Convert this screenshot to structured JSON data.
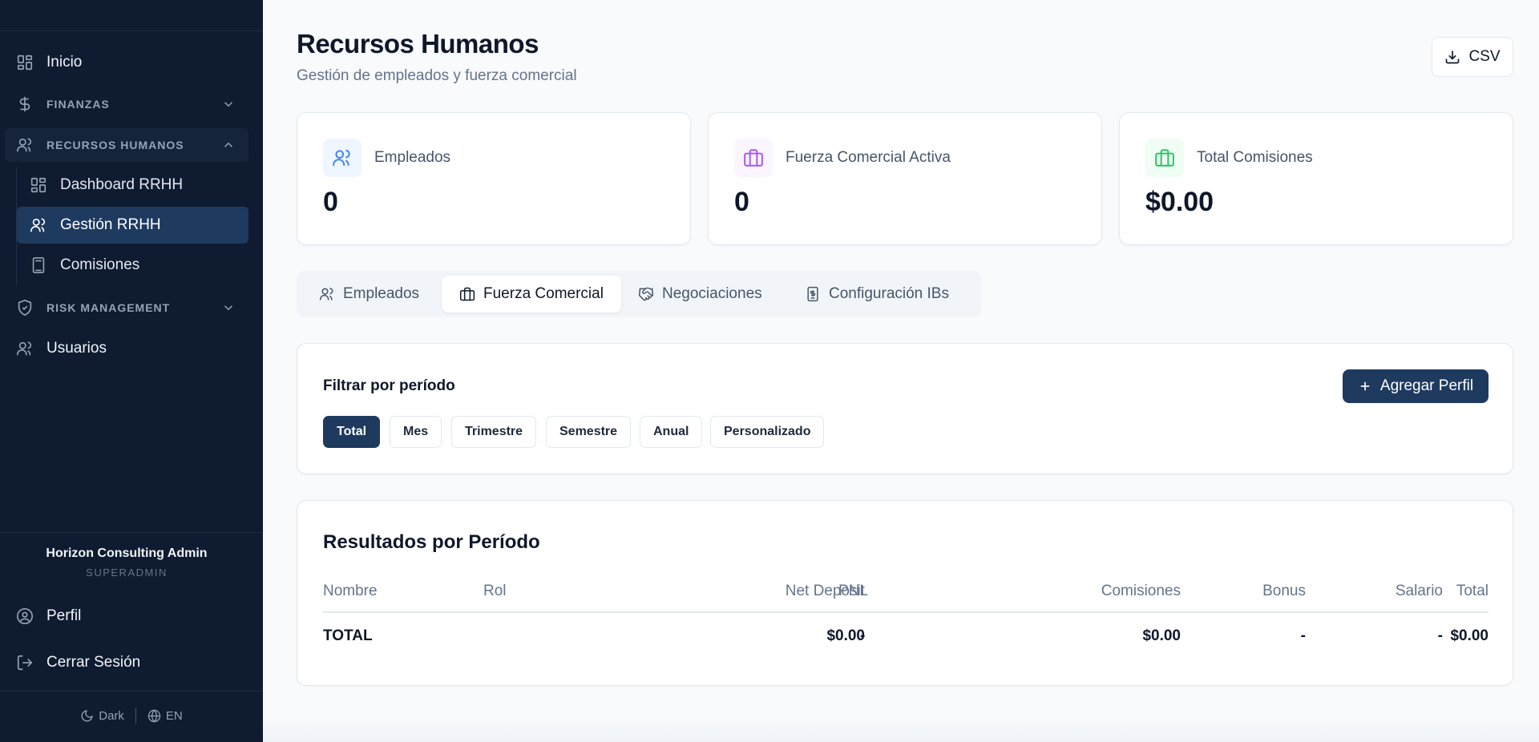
{
  "sidebar": {
    "inicio": "Inicio",
    "finanzas": "FINANZAS",
    "recursos_humanos": "RECURSOS HUMANOS",
    "sub_items": [
      "Dashboard RRHH",
      "Gestión RRHH",
      "Comisiones"
    ],
    "risk_management": "RISK MANAGEMENT",
    "usuarios": "Usuarios",
    "user_name": "Horizon Consulting Admin",
    "user_role": "SUPERADMIN",
    "perfil": "Perfil",
    "cerrar_sesion": "Cerrar Sesión",
    "theme_toggle": "Dark",
    "language_toggle": "EN"
  },
  "header": {
    "title": "Recursos Humanos",
    "subtitle": "Gestión de empleados y fuerza comercial",
    "csv_label": "CSV"
  },
  "stats": [
    {
      "label": "Empleados",
      "value": "0",
      "icon": "users-icon",
      "color": "#3b82f6"
    },
    {
      "label": "Fuerza Comercial Activa",
      "value": "0",
      "icon": "briefcase-icon",
      "color": "#a855f7"
    },
    {
      "label": "Total Comisiones",
      "value": "$0.00",
      "icon": "briefcase-icon",
      "color": "#22c55e"
    }
  ],
  "tabs": [
    "Empleados",
    "Fuerza Comercial",
    "Negociaciones",
    "Configuración IBs"
  ],
  "active_tab": "Fuerza Comercial",
  "filter": {
    "title": "Filtrar por período",
    "add_label": "Agregar Perfil",
    "periods": [
      "Total",
      "Mes",
      "Trimestre",
      "Semestre",
      "Anual",
      "Personalizado"
    ],
    "selected": "Total"
  },
  "results": {
    "title": "Resultados por Período",
    "columns": [
      "Nombre",
      "Rol",
      "Net Deposit",
      "PNL",
      "Comisiones",
      "Bonus",
      "Salario",
      "Total"
    ],
    "total_row": [
      "TOTAL",
      "",
      "$0.00",
      "-",
      "$0.00",
      "-",
      "-",
      "$0.00"
    ]
  },
  "colors": {
    "sidebar_bg": "#0f1b30",
    "primary": "#1e3a5f",
    "page_bg": "#f8fafc"
  }
}
